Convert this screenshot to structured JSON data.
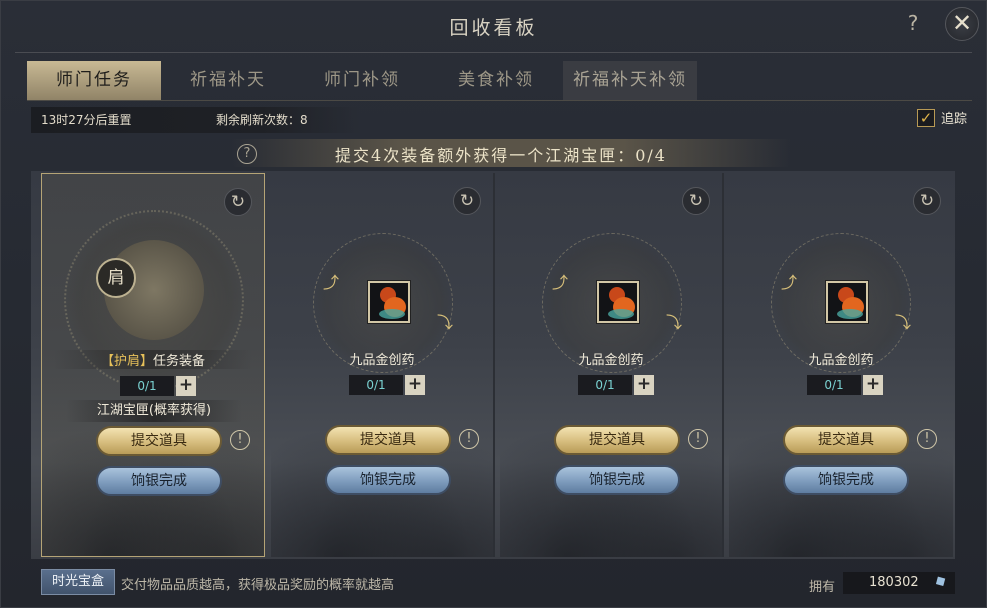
{
  "window": {
    "title": "回收看板",
    "help": "?",
    "close": "✕"
  },
  "tabs": [
    {
      "label": "师门任务"
    },
    {
      "label": "祈福补天"
    },
    {
      "label": "师门补领"
    },
    {
      "label": "美食补领"
    },
    {
      "label": "祈福补天补领"
    }
  ],
  "info": {
    "reset_text": "13时27分后重置",
    "refresh_text": "剩余刷新次数：8"
  },
  "track": {
    "label": "追踪",
    "checked": "✓"
  },
  "banner": {
    "help": "?",
    "text": "提交4次装备额外获得一个江湖宝匣：0/4"
  },
  "cards": [
    {
      "bracket": "【护肩】",
      "name": "任务装备",
      "emblem_tag": "肩",
      "qty": "0/1",
      "plus": "+",
      "reward": "江湖宝匣(概率获得)",
      "submit": "提交道具",
      "silver": "饷银完成",
      "warn": "!",
      "refresh": "↻"
    },
    {
      "name": "九品金创药",
      "qty": "0/1",
      "plus": "+",
      "submit": "提交道具",
      "silver": "饷银完成",
      "warn": "!",
      "refresh": "↻"
    },
    {
      "name": "九品金创药",
      "qty": "0/1",
      "plus": "+",
      "submit": "提交道具",
      "silver": "饷银完成",
      "warn": "!",
      "refresh": "↻"
    },
    {
      "name": "九品金创药",
      "qty": "0/1",
      "plus": "+",
      "submit": "提交道具",
      "silver": "饷银完成",
      "warn": "!",
      "refresh": "↻"
    }
  ],
  "footer": {
    "time_box": "时光宝盒",
    "hint": "交付物品品质越高，获得极品奖励的概率就越高",
    "owned_label": "拥有",
    "owned_value": "180302"
  }
}
